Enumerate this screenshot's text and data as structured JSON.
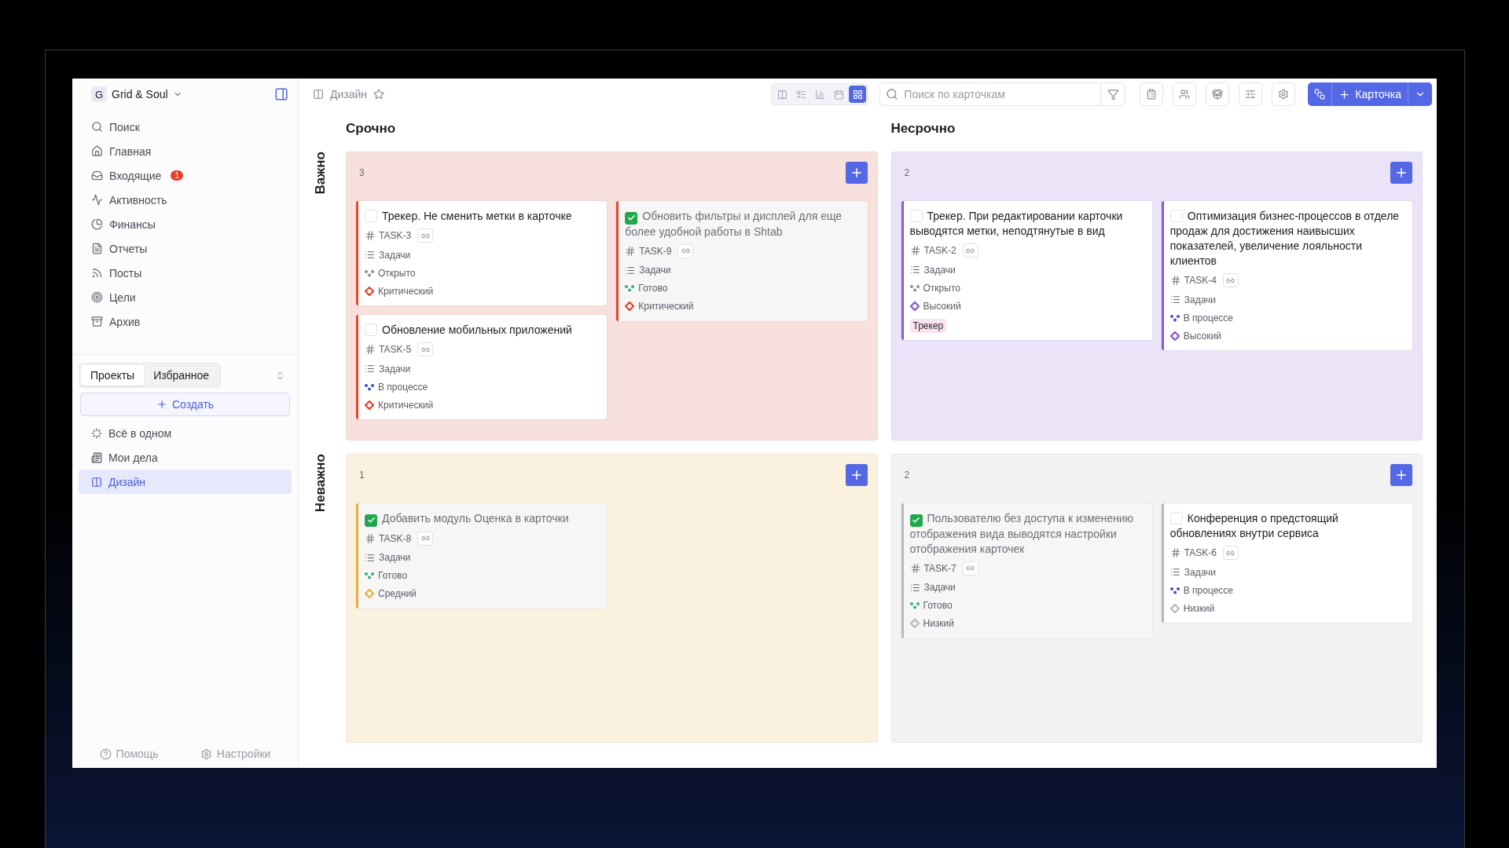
{
  "workspace": {
    "initial": "G",
    "name": "Grid & Soul"
  },
  "nav": [
    {
      "label": "Поиск"
    },
    {
      "label": "Главная"
    },
    {
      "label": "Входящие",
      "badge": "1"
    },
    {
      "label": "Активность"
    },
    {
      "label": "Финансы"
    },
    {
      "label": "Отчеты"
    },
    {
      "label": "Посты"
    },
    {
      "label": "Цели"
    },
    {
      "label": "Архив"
    }
  ],
  "sidebar_tabs": [
    {
      "label": "Проекты",
      "selected": true
    },
    {
      "label": "Избранное",
      "selected": false
    }
  ],
  "create_button": "Создать",
  "projects": [
    {
      "label": "Всё в одном",
      "selected": false
    },
    {
      "label": "Мои дела",
      "selected": false
    },
    {
      "label": "Дизайн",
      "selected": true
    }
  ],
  "footer": [
    {
      "label": "Помощь"
    },
    {
      "label": "Настройки"
    }
  ],
  "breadcrumb": "Дизайн",
  "view_switch": [
    {
      "selected": false
    },
    {
      "selected": false
    },
    {
      "selected": false
    },
    {
      "selected": false
    },
    {
      "selected": true
    }
  ],
  "search": {
    "placeholder": "Поиск по карточкам"
  },
  "add_button": "Карточка",
  "column_headings": [
    "Срочно",
    "Несрочно"
  ],
  "row_headings": [
    "Важно",
    "Неважно"
  ],
  "quadrants": [
    {
      "count": "3",
      "color": "#e0492f",
      "lanes": [
        [
          {
            "title": "Трекер. Не сменить метки в карточке",
            "done": false,
            "id": "TASK-3",
            "type": "Задачи",
            "status": {
              "label": "Открыто",
              "kind": "open"
            },
            "priority": {
              "label": "Критический",
              "kind": "critical"
            }
          },
          {
            "title": "Обновление мобильных приложений",
            "done": false,
            "id": "TASK-5",
            "type": "Задачи",
            "status": {
              "label": "В процессе",
              "kind": "progress"
            },
            "priority": {
              "label": "Критический",
              "kind": "critical"
            }
          }
        ],
        [
          {
            "title": "Обновить фильтры и дисплей для еще более удобной работы в Shtab",
            "done": true,
            "id": "TASK-9",
            "type": "Задачи",
            "status": {
              "label": "Готово",
              "kind": "done"
            },
            "priority": {
              "label": "Критический",
              "kind": "critical"
            }
          }
        ]
      ]
    },
    {
      "count": "2",
      "color": "#8b5cd6",
      "lanes": [
        [
          {
            "title": "Трекер. При редактировании карточки выводятся метки, неподтянутые в вид",
            "done": false,
            "id": "TASK-2",
            "type": "Задачи",
            "status": {
              "label": "Открыто",
              "kind": "open"
            },
            "priority": {
              "label": "Высокий",
              "kind": "high"
            },
            "tags": [
              "Трекер"
            ]
          }
        ],
        [
          {
            "title": "Оптимизация бизнес-процессов в отделе продаж для достижения наивысших показателей, увеличение лояльности клиентов",
            "done": false,
            "id": "TASK-4",
            "type": "Задачи",
            "status": {
              "label": "В процессе",
              "kind": "progress"
            },
            "priority": {
              "label": "Высокий",
              "kind": "high"
            }
          }
        ]
      ]
    },
    {
      "count": "1",
      "color": "#eab03a",
      "lanes": [
        [
          {
            "title": "Добавить модуль Оценка в карточки",
            "done": true,
            "id": "TASK-8",
            "type": "Задачи",
            "status": {
              "label": "Готово",
              "kind": "done"
            },
            "priority": {
              "label": "Средний",
              "kind": "medium"
            }
          }
        ]
      ]
    },
    {
      "count": "2",
      "color": "#b8b8c0",
      "lanes": [
        [
          {
            "title": "Пользователю без доступа к изменению отображения вида выводятся настройки отображения карточек",
            "done": true,
            "id": "TASK-7",
            "type": "Задачи",
            "status": {
              "label": "Готово",
              "kind": "done"
            },
            "priority": {
              "label": "Низкий",
              "kind": "low"
            }
          }
        ],
        [
          {
            "title": "Конференция о предстоящий обновлениях внутри сервиса",
            "done": false,
            "id": "TASK-6",
            "type": "Задачи",
            "status": {
              "label": "В процессе",
              "kind": "progress"
            },
            "priority": {
              "label": "Низкий",
              "kind": "low"
            }
          }
        ]
      ]
    }
  ]
}
